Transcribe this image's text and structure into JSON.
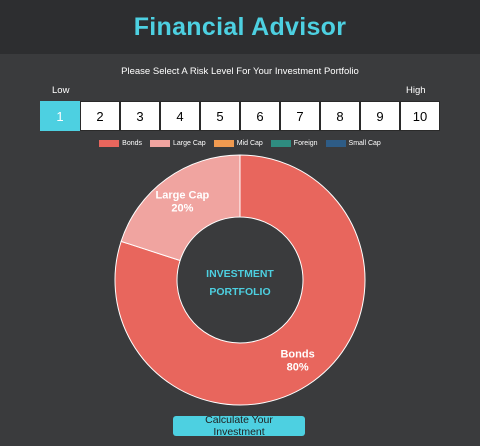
{
  "header": {
    "title": "Financial Advisor"
  },
  "risk": {
    "prompt": "Please Select A Risk Level For Your Investment Portfolio",
    "low_label": "Low",
    "high_label": "High",
    "levels": [
      "1",
      "2",
      "3",
      "4",
      "5",
      "6",
      "7",
      "8",
      "9",
      "10"
    ],
    "selected": "1",
    "active_color": "#4dd0e1"
  },
  "chart_data": {
    "type": "pie",
    "center_label_line1": "INVESTMENT",
    "center_label_line2": "PORTFOLIO",
    "slices": [
      {
        "name": "Bonds",
        "value": 80,
        "color": "#e8665d",
        "label": "80%"
      },
      {
        "name": "Large Cap",
        "value": 20,
        "color": "#f0a4a0",
        "label": "20%"
      },
      {
        "name": "Mid Cap",
        "value": 0,
        "color": "#f09a50"
      },
      {
        "name": "Foreign",
        "value": 0,
        "color": "#2f8c80"
      },
      {
        "name": "Small Cap",
        "value": 0,
        "color": "#2e5c86"
      }
    ]
  },
  "actions": {
    "calculate_label": "Calculate Your Investment"
  }
}
